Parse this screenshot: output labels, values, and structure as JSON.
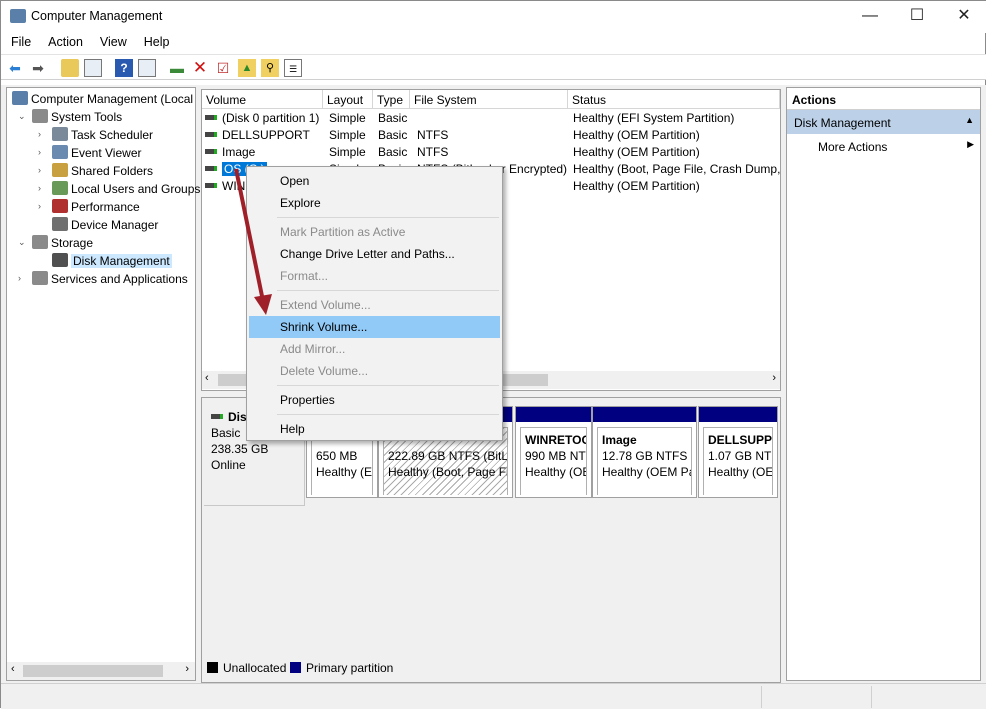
{
  "window": {
    "title": "Computer Management",
    "minimize": "—",
    "maximize": "☐",
    "close": "✕"
  },
  "menu": [
    "File",
    "Action",
    "View",
    "Help"
  ],
  "toolbar": [
    "back-icon",
    "forward-icon",
    "up-folder-icon",
    "show-hide-tree-icon",
    "help-icon",
    "properties-view-icon",
    "connect-icon",
    "delete-icon",
    "check-icon",
    "up-arrow-folder-icon",
    "search-folder-icon",
    "list-properties-icon"
  ],
  "tree": [
    {
      "label": "Computer Management (Local",
      "level": 0,
      "exp": ""
    },
    {
      "label": "System Tools",
      "level": 1,
      "exp": "⌄"
    },
    {
      "label": "Task Scheduler",
      "level": 2,
      "exp": "›"
    },
    {
      "label": "Event Viewer",
      "level": 2,
      "exp": "›"
    },
    {
      "label": "Shared Folders",
      "level": 2,
      "exp": "›"
    },
    {
      "label": "Local Users and Groups",
      "level": 2,
      "exp": "›"
    },
    {
      "label": "Performance",
      "level": 2,
      "exp": "›"
    },
    {
      "label": "Device Manager",
      "level": 2,
      "exp": ""
    },
    {
      "label": "Storage",
      "level": 1,
      "exp": "⌄"
    },
    {
      "label": "Disk Management",
      "level": 2,
      "exp": "",
      "selected": true
    },
    {
      "label": "Services and Applications",
      "level": 1,
      "exp": "›"
    }
  ],
  "volumes": {
    "columns": [
      "Volume",
      "Layout",
      "Type",
      "File System",
      "Status"
    ],
    "rows": [
      [
        "(Disk 0 partition 1)",
        "Simple",
        "Basic",
        "",
        "Healthy (EFI System Partition)"
      ],
      [
        "DELLSUPPORT",
        "Simple",
        "Basic",
        "NTFS",
        "Healthy (OEM Partition)"
      ],
      [
        "Image",
        "Simple",
        "Basic",
        "NTFS",
        "Healthy (OEM Partition)"
      ],
      [
        "OS (C:)",
        "Simple",
        "Basic",
        "NTFS (BitLocker Encrypted)",
        "Healthy (Boot, Page File, Crash Dump, P"
      ],
      [
        "WINRETOOLS",
        "Simple",
        "Basic",
        "NTFS",
        "Healthy (OEM Partition)"
      ]
    ]
  },
  "disk": {
    "name": "Disk 0",
    "type": "Basic",
    "size": "238.35 GB",
    "state": "Online",
    "partitions": [
      {
        "name": "",
        "size": "650 MB",
        "status": "Healthy (EI"
      },
      {
        "name": "",
        "size": "222.89 GB NTFS (BitLoc",
        "status": "Healthy (Boot, Page Fil"
      },
      {
        "name": "WINRETOOLS",
        "size": "990 MB NTI",
        "status": "Healthy (OE"
      },
      {
        "name": "Image",
        "size": "12.78 GB NTFS",
        "status": "Healthy (OEM Pa"
      },
      {
        "name": "DELLSUPPO",
        "size": "1.07 GB NTF",
        "status": "Healthy (OE"
      }
    ]
  },
  "legend": [
    {
      "label": "Unallocated",
      "color": "#000000"
    },
    {
      "label": "Primary partition",
      "color": "#000080"
    }
  ],
  "actions": {
    "header": "Actions",
    "section": "Disk Management",
    "item": "More Actions"
  },
  "context_menu": [
    {
      "label": "Open"
    },
    {
      "label": "Explore"
    },
    {
      "sep": true
    },
    {
      "label": "Mark Partition as Active",
      "disabled": true
    },
    {
      "label": "Change Drive Letter and Paths..."
    },
    {
      "label": "Format...",
      "disabled": true
    },
    {
      "sep": true
    },
    {
      "label": "Extend Volume...",
      "disabled": true
    },
    {
      "label": "Shrink Volume...",
      "highlighted": true
    },
    {
      "label": "Add Mirror...",
      "disabled": true
    },
    {
      "label": "Delete Volume...",
      "disabled": true
    },
    {
      "sep": true
    },
    {
      "label": "Properties"
    },
    {
      "sep": true
    },
    {
      "label": "Help"
    }
  ],
  "colors": {
    "selection": "#0078d7",
    "menu_highlight": "#91c9f7",
    "primary_partition": "#000080",
    "arrow": "#a0202a"
  }
}
